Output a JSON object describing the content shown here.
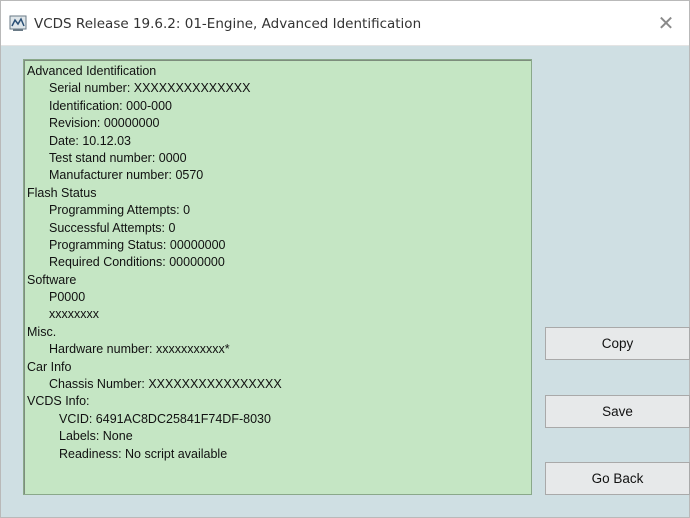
{
  "window": {
    "title": "VCDS Release 19.6.2: 01-Engine,  Advanced Identification",
    "icon": "vcds-app-icon",
    "close_symbol": "✕"
  },
  "info": {
    "advanced_identification": {
      "heading": "Advanced Identification",
      "serial": "Serial number: XXXXXXXXXXXXXX",
      "identification": "Identification: 000-000",
      "revision": "Revision: 00000000",
      "date": "Date: 10.12.03",
      "test_stand": "Test stand number: 0000",
      "manufacturer": "Manufacturer number: 0570"
    },
    "flash_status": {
      "heading": "Flash Status",
      "programming_attempts": "Programming Attempts: 0",
      "successful_attempts": "Successful Attempts: 0",
      "programming_status": "Programming Status: 00000000",
      "required_conditions": "Required Conditions: 00000000"
    },
    "software": {
      "heading": "Software",
      "line1": "P0000",
      "line2": "xxxxxxxx"
    },
    "misc": {
      "heading": "Misc.",
      "hardware_number": "Hardware number: xxxxxxxxxxx*"
    },
    "car_info": {
      "heading": "Car Info",
      "chassis_number": "Chassis Number: XXXXXXXXXXXXXXXX"
    },
    "vcds_info": {
      "heading": "VCDS Info:",
      "vcid": "VCID: 6491AC8DC25841F74DF-8030",
      "labels": "Labels: None",
      "readiness": "Readiness: No script available"
    }
  },
  "buttons": {
    "copy": "Copy",
    "save": "Save",
    "go_back": "Go Back"
  },
  "colors": {
    "panel_background": "#c5e6c4",
    "dialog_background": "#cfdfe3"
  }
}
